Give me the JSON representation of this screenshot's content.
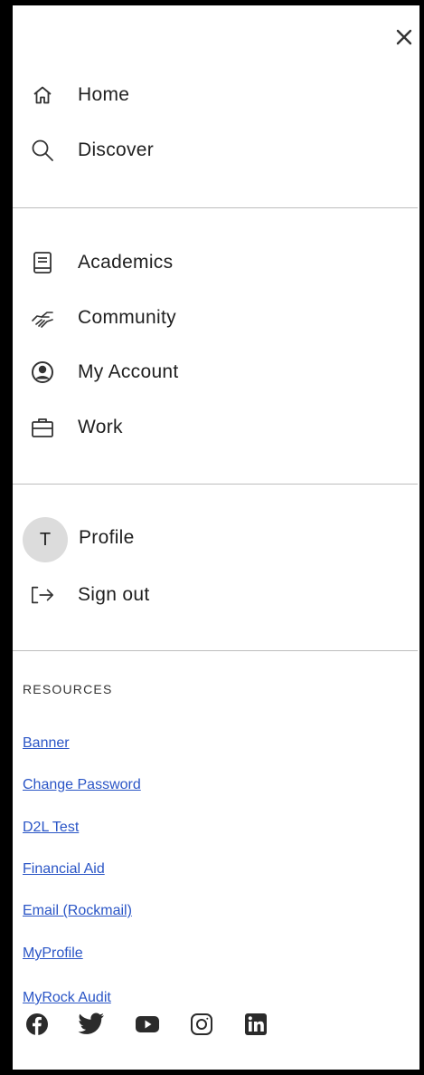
{
  "nav_primary": [
    {
      "label": "Home",
      "icon": "home-icon"
    },
    {
      "label": "Discover",
      "icon": "search-icon"
    }
  ],
  "nav_secondary": [
    {
      "label": "Academics",
      "icon": "book-icon"
    },
    {
      "label": "Community",
      "icon": "handshake-icon"
    },
    {
      "label": "My Account",
      "icon": "account-circle-icon"
    },
    {
      "label": "Work",
      "icon": "briefcase-icon"
    }
  ],
  "user": {
    "avatar_initial": "T",
    "profile_label": "Profile",
    "signout_label": "Sign out"
  },
  "resources": {
    "title": "RESOURCES",
    "links": [
      "Banner",
      "Change Password",
      "D2L Test",
      "Financial Aid",
      "Email (Rockmail)",
      "MyProfile",
      "MyRock Audit"
    ]
  },
  "social_icons": [
    "facebook-icon",
    "twitter-icon",
    "youtube-icon",
    "instagram-icon",
    "linkedin-icon"
  ],
  "colors": {
    "link": "#2a55c6",
    "text": "#1f1f1f",
    "divider": "#bdbdbd",
    "avatar_bg": "#dcdcdc"
  }
}
